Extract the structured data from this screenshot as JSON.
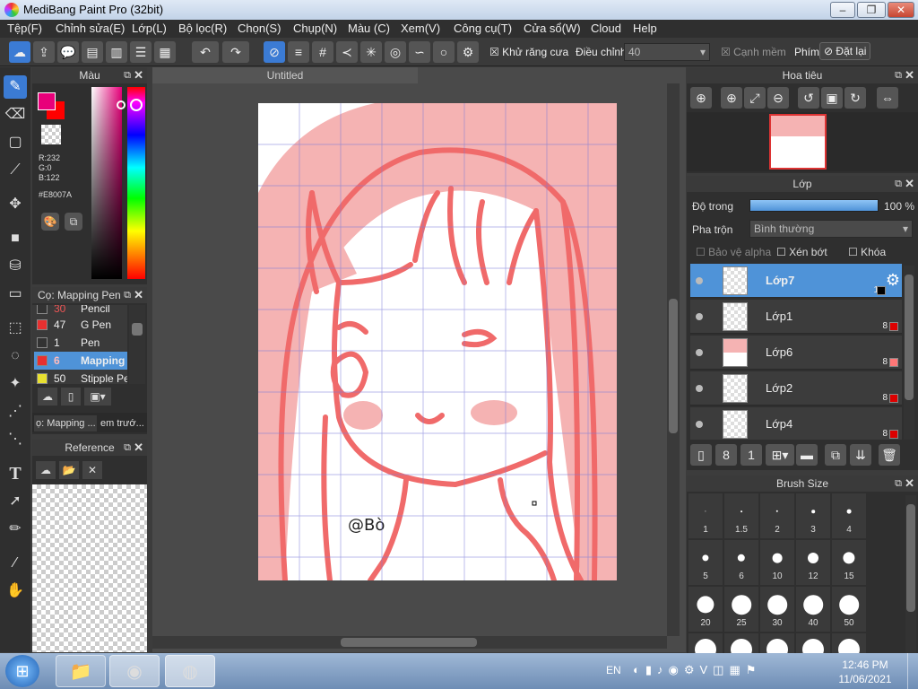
{
  "window": {
    "title": "MediBang Paint Pro (32bit)"
  },
  "menu": [
    "Tệp(F)",
    "Chỉnh sửa(E)",
    "Lớp(L)",
    "Bộ lọc(R)",
    "Chọn(S)",
    "Chụp(N)",
    "Màu (C)",
    "Xem(V)",
    "Công cụ(T)",
    "Cửa sổ(W)",
    "Cloud",
    "Help"
  ],
  "toolbar": {
    "antialias_label": "Khử răng cưa",
    "adjust_label": "Điều chỉnh",
    "adjust_value": "40",
    "smooth_label": "Cạnh mềm",
    "key_label": "Phím",
    "reset_label": "Đặt lại"
  },
  "color_panel": {
    "title": "Màu",
    "r": "R:232",
    "g": "G:0",
    "b": "B:122",
    "hex": "#E8007A",
    "primary": "#e8007a",
    "secondary": "#ff0000"
  },
  "brush_panel": {
    "title": "Cọ: Mapping Pen",
    "items": [
      {
        "size": "30",
        "name": "Pencil",
        "color": "#333333"
      },
      {
        "size": "47",
        "name": "G Pen",
        "color": "#e83030"
      },
      {
        "size": "1",
        "name": "Pen",
        "color": "#333333"
      },
      {
        "size": "6",
        "name": "Mapping",
        "color": "#e83030"
      },
      {
        "size": "50",
        "name": "Stipple Pen",
        "color": "#e8e030"
      }
    ],
    "tab1": "ọ: Mapping ...",
    "tab2": "em trướ..."
  },
  "reference_panel": {
    "title": "Reference"
  },
  "document": {
    "tab": "Untitled",
    "signature": "@Bò"
  },
  "navigator": {
    "title": "Hoa tiêu"
  },
  "layer_panel": {
    "title": "Lớp",
    "opacity_label": "Độ trong",
    "opacity_value": "100 %",
    "opacity": 1.0,
    "blend_label": "Pha trộn",
    "blend_value": "Bình thường",
    "protect_alpha": "Bảo vệ alpha",
    "clipping": "Xén bớt",
    "lock": "Khóa",
    "layers": [
      {
        "name": "Lớp7",
        "op": "1"
      },
      {
        "name": "Lớp1",
        "op": "8"
      },
      {
        "name": "Lớp6",
        "op": "8"
      },
      {
        "name": "Lớp2",
        "op": "8"
      },
      {
        "name": "Lớp4",
        "op": "8"
      }
    ]
  },
  "brush_size_panel": {
    "title": "Brush Size",
    "sizes": [
      "1",
      "1.5",
      "2",
      "3",
      "4",
      "5",
      "6",
      "10",
      "12",
      "15",
      "20",
      "25",
      "30",
      "40",
      "50"
    ]
  },
  "taskbar": {
    "lang": "EN",
    "time": "12:46 PM",
    "date": "11/06/2021"
  }
}
